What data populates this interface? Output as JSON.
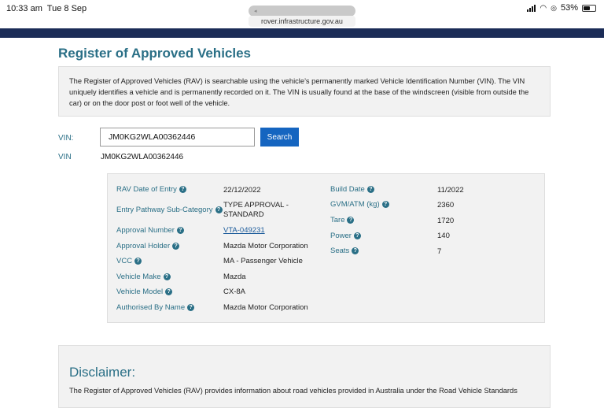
{
  "status_bar": {
    "time": "10:33 am",
    "date": "Tue 8 Sep",
    "battery": "53%"
  },
  "browser": {
    "url": "rover.infrastructure.gov.au"
  },
  "page": {
    "title": "Register of Approved Vehicles",
    "intro": "The Register of Approved Vehicles (RAV) is searchable using the vehicle’s permanently marked Vehicle Identification Number (VIN). The VIN uniquely identifies a vehicle and is permanently recorded on it. The VIN is usually found at the base of the windscreen (visible from outside the car) or on the door post or foot well of the vehicle."
  },
  "search": {
    "label": "VIN:",
    "value": "JM0KG2WLA00362446",
    "button": "Search",
    "result_label": "VIN",
    "result_value": "JM0KG2WLA00362446"
  },
  "details": {
    "left": [
      {
        "label": "RAV Date of Entry",
        "value": "22/12/2022"
      },
      {
        "label": "Entry Pathway Sub-Category",
        "value": "TYPE APPROVAL - STANDARD"
      },
      {
        "label": "Approval Number",
        "value": "VTA-049231"
      },
      {
        "label": "Approval Holder",
        "value": "Mazda Motor Corporation"
      },
      {
        "label": "VCC",
        "value": "MA - Passenger Vehicle"
      },
      {
        "label": "Vehicle Make",
        "value": "Mazda"
      },
      {
        "label": "Vehicle Model",
        "value": "CX-8A"
      },
      {
        "label": "Authorised By Name",
        "value": "Mazda Motor Corporation"
      }
    ],
    "right": [
      {
        "label": "Build Date",
        "value": "11/2022"
      },
      {
        "label": "GVM/ATM (kg)",
        "value": "2360"
      },
      {
        "label": "Tare",
        "value": "1720"
      },
      {
        "label": "Power",
        "value": "140"
      },
      {
        "label": "Seats",
        "value": "7"
      }
    ]
  },
  "disclaimer": {
    "title": "Disclaimer:",
    "text": "The Register of Approved Vehicles (RAV) provides information about road vehicles provided in Australia under the Road Vehicle Standards"
  }
}
